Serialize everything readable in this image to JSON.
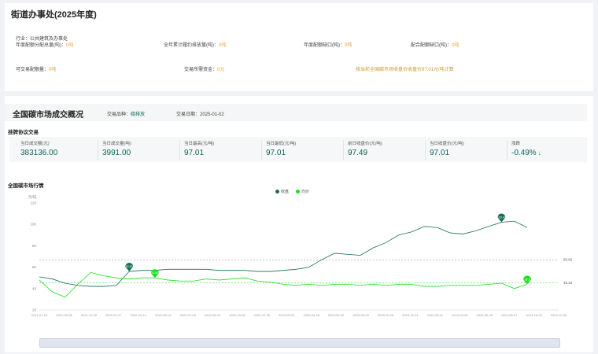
{
  "header": {
    "title": "街道办事处(2025年度)"
  },
  "info": {
    "industry": "行业：公共建筑及办事处",
    "alloc_label": "年度配额分配总量(吨)：",
    "alloc_value": "0吨",
    "annual_emission_label": "全年累计履约排放量(吨)：",
    "annual_emission_value": "0吨",
    "year_gap_label": "年度配额缺口(吨)：",
    "year_gap_value": "0吨",
    "bought_label": "配合配额缺口(吨)：",
    "bought_value": "0吨",
    "remain_label": "可交易配额量：",
    "remain_value": "0吨",
    "trade_cost_label": "交易所需资金：",
    "trade_cost_value": "0元",
    "note": "按当前全国碳市场收盘价收盘价97.01元/吨计算"
  },
  "market": {
    "title": "全国碳市场成交概况",
    "product_label": "交易品种：",
    "product_value": "碳排放",
    "date_label": "交易日期：",
    "date_value": "2025-01-02",
    "listing_title": "挂牌协议交易",
    "stats": [
      {
        "label": "当日成交额(元)",
        "value": "383136.00"
      },
      {
        "label": "当日成交量(吨)",
        "value": "3991.00"
      },
      {
        "label": "当日最高(元/吨)",
        "value": "97.01"
      },
      {
        "label": "当日最低(元/吨)",
        "value": "97.01"
      },
      {
        "label": "前日收盘价(元/吨)",
        "value": "97.49"
      },
      {
        "label": "当日收盘价(元/吨)",
        "value": "97.01"
      },
      {
        "label": "涨跌",
        "value": "-0.49%",
        "trend": "↓"
      }
    ]
  },
  "chart_data": {
    "type": "line",
    "title": "全国碳市场行情",
    "ylabel": "元/吨",
    "ylim": [
      20,
      120
    ],
    "yticks": [
      20,
      40,
      60,
      80,
      100,
      120
    ],
    "x_ticks": [
      "2021-07-16",
      "2021-09-08",
      "2021-11-08",
      "2022-01-07",
      "2022-03-11",
      "2022-05-13",
      "2022-07-05",
      "2022-08-31",
      "2022-10-28",
      "2022-12-26",
      "2023-03-01",
      "2023-04-28",
      "2023-06-30",
      "2023-08-25",
      "2023-10-25",
      "2023-12-21",
      "2024-03-01",
      "2024-04-30",
      "2024-06-28",
      "2024-08-27",
      "2024-10-25",
      "2024-12-30"
    ],
    "series": [
      {
        "name": "收盘",
        "color": "#166e55",
        "values": [
          51,
          49,
          45,
          43,
          42,
          42,
          43,
          56,
          57,
          57,
          58,
          58,
          58,
          58,
          57,
          57,
          57,
          56,
          56,
          57,
          58,
          60,
          67,
          73,
          72,
          71,
          78,
          83,
          90,
          93,
          98,
          97,
          92,
          91,
          94,
          98,
          102,
          103,
          97
        ]
      },
      {
        "name": "均价",
        "color": "#19e01c",
        "values": [
          48,
          37,
          32,
          44,
          55,
          52,
          50,
          49,
          50,
          50,
          48,
          47,
          47,
          49,
          48,
          49,
          50,
          47,
          46,
          44,
          43,
          44,
          43,
          44,
          44,
          43,
          44,
          43,
          44,
          44,
          42,
          42,
          43,
          43,
          43,
          44,
          45,
          40,
          44
        ]
      }
    ],
    "markers": [
      {
        "series": "收盘",
        "label": "52.83"
      },
      {
        "series": "均价",
        "label": "61.60"
      },
      {
        "series": "收盘",
        "label": "103.49"
      },
      {
        "series": "均价",
        "label": "35.3"
      }
    ],
    "ref_lines": [
      {
        "value": 66.92,
        "label": "66.92"
      },
      {
        "value": 45.34,
        "label": "45.34"
      }
    ],
    "legend": "top-center"
  },
  "colors": {
    "primary": "#0e6655",
    "line_close": "#166e55",
    "line_avg": "#19e01c",
    "warning": "#e6a23c"
  }
}
